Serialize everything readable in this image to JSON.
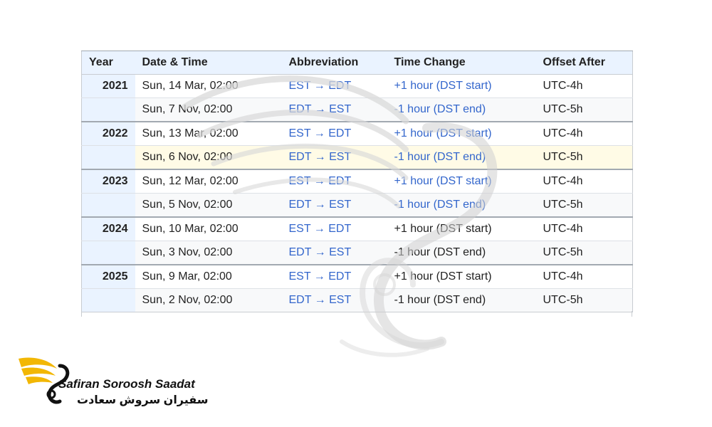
{
  "table": {
    "headers": [
      "Year",
      "Date & Time",
      "Abbreviation",
      "Time Change",
      "Offset After"
    ],
    "rows": [
      {
        "year": "2021",
        "date": "Sun, 14 Mar, 02:00",
        "abbr": "EST → EDT",
        "change": "+1 hour (DST start)",
        "offset": "UTC-4h"
      },
      {
        "year": "",
        "date": "Sun, 7 Nov, 02:00",
        "abbr": "EDT → EST",
        "change": "-1 hour (DST end)",
        "offset": "UTC-5h"
      },
      {
        "year": "2022",
        "date": "Sun, 13 Mar, 02:00",
        "abbr": "EST → EDT",
        "change": "+1 hour (DST start)",
        "offset": "UTC-4h"
      },
      {
        "year": "",
        "date": "Sun, 6 Nov, 02:00",
        "abbr": "EDT → EST",
        "change": "-1 hour (DST end)",
        "offset": "UTC-5h"
      },
      {
        "year": "2023",
        "date": "Sun, 12 Mar, 02:00",
        "abbr": "EST → EDT",
        "change": "+1 hour (DST start)",
        "offset": "UTC-4h"
      },
      {
        "year": "",
        "date": "Sun, 5 Nov, 02:00",
        "abbr": "EDT → EST",
        "change": "-1 hour (DST end)",
        "offset": "UTC-5h"
      },
      {
        "year": "2024",
        "date": "Sun, 10 Mar, 02:00",
        "abbr": "EST → EDT",
        "change": "+1 hour (DST start)",
        "offset": "UTC-4h"
      },
      {
        "year": "",
        "date": "Sun, 3 Nov, 02:00",
        "abbr": "EDT → EST",
        "change": "-1 hour (DST end)",
        "offset": "UTC-5h"
      },
      {
        "year": "2025",
        "date": "Sun, 9 Mar, 02:00",
        "abbr": "EST → EDT",
        "change": "+1 hour (DST start)",
        "offset": "UTC-4h"
      },
      {
        "year": "",
        "date": "Sun, 2 Nov, 02:00",
        "abbr": "EDT → EST",
        "change": "-1 hour (DST end)",
        "offset": "UTC-5h"
      }
    ]
  },
  "logo": {
    "name_en": "Safiran Soroosh Saadat",
    "name_fa": "سفیران سروش سعادت",
    "icon": "swan-logo-icon"
  },
  "watermark": {
    "icon": "swan-watermark-icon"
  },
  "colors": {
    "link_blue": "#3366cc",
    "header_bg": "#eaf3ff",
    "highlight_row": "#fffbe6",
    "logo_gold": "#f2b705"
  }
}
